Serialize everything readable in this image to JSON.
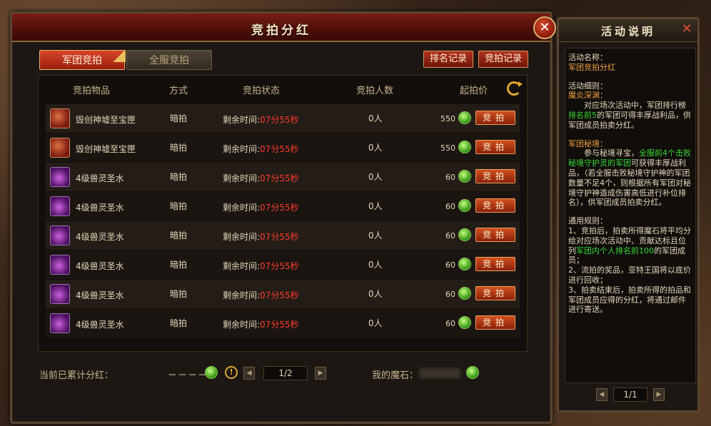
{
  "main": {
    "title": "竞拍分红",
    "close_glyph": "✕",
    "tabs": [
      {
        "label": "军团竞拍",
        "active": true
      },
      {
        "label": "全服竞拍",
        "active": false
      }
    ],
    "rank_button": "排名记录",
    "bid_record_button": "竞拍记录",
    "columns": {
      "item": "竞拍物品",
      "method": "方式",
      "status": "竞拍状态",
      "bidders": "竞拍人数",
      "price": "起拍价"
    },
    "rows": [
      {
        "icon": "chest-icon",
        "name": "毁创神墟至宝匣",
        "method": "暗拍",
        "status_label": "剩余时间:",
        "time": "07分55秒",
        "bidders": "0人",
        "price": "550",
        "bid": "竞拍"
      },
      {
        "icon": "chest-icon",
        "name": "毁创神墟至宝匣",
        "method": "暗拍",
        "status_label": "剩余时间:",
        "time": "07分55秒",
        "bidders": "0人",
        "price": "550",
        "bid": "竞拍"
      },
      {
        "icon": "potion-icon",
        "name": "4级兽灵圣水",
        "method": "暗拍",
        "status_label": "剩余时间:",
        "time": "07分55秒",
        "bidders": "0人",
        "price": "60",
        "bid": "竞拍"
      },
      {
        "icon": "potion-icon",
        "name": "4级兽灵圣水",
        "method": "暗拍",
        "status_label": "剩余时间:",
        "time": "07分55秒",
        "bidders": "0人",
        "price": "60",
        "bid": "竞拍"
      },
      {
        "icon": "potion-icon",
        "name": "4级兽灵圣水",
        "method": "暗拍",
        "status_label": "剩余时间:",
        "time": "07分55秒",
        "bidders": "0人",
        "price": "60",
        "bid": "竞拍"
      },
      {
        "icon": "potion-icon",
        "name": "4级兽灵圣水",
        "method": "暗拍",
        "status_label": "剩余时间:",
        "time": "07分55秒",
        "bidders": "0人",
        "price": "60",
        "bid": "竞拍"
      },
      {
        "icon": "potion-icon",
        "name": "4级兽灵圣水",
        "method": "暗拍",
        "status_label": "剩余时间:",
        "time": "07分55秒",
        "bidders": "0人",
        "price": "60",
        "bid": "竞拍"
      },
      {
        "icon": "potion-icon",
        "name": "4级兽灵圣水",
        "method": "暗拍",
        "status_label": "剩余时间:",
        "time": "07分55秒",
        "bidders": "0人",
        "price": "60",
        "bid": "竞拍"
      }
    ],
    "footer": {
      "accum_label": "当前已累计分红：",
      "accum_value": "－－－－",
      "info_glyph": "!",
      "prev_glyph": "◀",
      "next_glyph": "▶",
      "page": "1/2",
      "mystone_label": "我的魔石："
    }
  },
  "side": {
    "title": "活动说明",
    "close_glyph": "✕",
    "s1_label": "活动名称：",
    "s1_value": "军团竞拍分红",
    "s2_label": "活动细则：",
    "s2_sub": "魔炎深渊：",
    "s2_text_a": "对应场次活动中，军团排行榜",
    "s2_hl": "排名前5",
    "s2_text_b": "的军团可得丰厚战利品，供军团成员拍卖分红。",
    "s3_label": "军团秘境：",
    "s3_text_a": "参与秘境寻宝，",
    "s3_hl": "全服前4个击败秘境守护灵的军团",
    "s3_text_b": "可获得丰厚战利品，（若全服击败秘境守护神的军团数量不足4个，则根据所有军团对秘境守护神造成伤害高低进行补位排名），供军团成员拍卖分红。",
    "s4_label": "通用规则：",
    "s4_r1_a": "1、竞拍后，拍卖所得魔石将平均分给对应场次活动中、贡献达标且位列",
    "s4_r1_hl": "军团内个人排名前100",
    "s4_r1_b": "的军团成员；",
    "s4_r2": "2、流拍的奖品，亚特王国将以底价进行回收；",
    "s4_r3": "3、拍卖结束后，拍卖所得的拍品和军团成员应得的分红，将通过邮件进行寄送。",
    "prev_glyph": "◀",
    "next_glyph": "▶",
    "page": "1/1"
  }
}
